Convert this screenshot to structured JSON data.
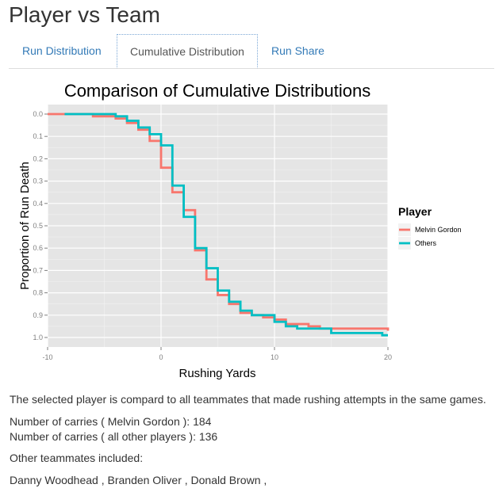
{
  "page": {
    "title": "Player vs Team"
  },
  "tabs": [
    {
      "label": "Run Distribution",
      "active": false
    },
    {
      "label": "Cumulative Distribution",
      "active": true
    },
    {
      "label": "Run Share",
      "active": false
    }
  ],
  "chart_data": {
    "type": "line",
    "subtype": "step",
    "title": "Comparison of Cumulative Distributions",
    "xlabel": "Rushing Yards",
    "ylabel": "Proportion of Run Death",
    "xlim": [
      -10,
      20
    ],
    "ylim": [
      0.0,
      1.0
    ],
    "y_reversed": true,
    "x_ticks": [
      -10,
      0,
      10,
      20
    ],
    "y_ticks": [
      "0.0",
      "0.1",
      "0.2",
      "0.3",
      "0.4",
      "0.5",
      "0.6",
      "0.7",
      "0.8",
      "0.9",
      "1.0"
    ],
    "grid": true,
    "background": "#e5e5e5",
    "legend": {
      "title": "Player",
      "position": "right"
    },
    "series": [
      {
        "name": "Melvin Gordon",
        "color": "#f8766d",
        "points": [
          [
            -10,
            0.0
          ],
          [
            -6,
            0.01
          ],
          [
            -4,
            0.02
          ],
          [
            -3,
            0.04
          ],
          [
            -2,
            0.07
          ],
          [
            -1,
            0.12
          ],
          [
            0,
            0.24
          ],
          [
            1,
            0.35
          ],
          [
            2,
            0.43
          ],
          [
            3,
            0.61
          ],
          [
            4,
            0.74
          ],
          [
            5,
            0.81
          ],
          [
            6,
            0.85
          ],
          [
            7,
            0.89
          ],
          [
            8,
            0.9
          ],
          [
            9,
            0.91
          ],
          [
            10,
            0.92
          ],
          [
            11,
            0.94
          ],
          [
            13,
            0.95
          ],
          [
            14,
            0.96
          ],
          [
            20,
            0.97
          ]
        ]
      },
      {
        "name": "Others",
        "color": "#00bfc4",
        "points": [
          [
            -8.5,
            0.0
          ],
          [
            -4,
            0.01
          ],
          [
            -3,
            0.03
          ],
          [
            -2,
            0.06
          ],
          [
            -1,
            0.09
          ],
          [
            0,
            0.14
          ],
          [
            1,
            0.32
          ],
          [
            2,
            0.46
          ],
          [
            3,
            0.6
          ],
          [
            4,
            0.69
          ],
          [
            5,
            0.79
          ],
          [
            6,
            0.84
          ],
          [
            7,
            0.88
          ],
          [
            8,
            0.9
          ],
          [
            10,
            0.93
          ],
          [
            11,
            0.95
          ],
          [
            12,
            0.96
          ],
          [
            15,
            0.98
          ],
          [
            19.5,
            0.99
          ],
          [
            20,
            0.99
          ]
        ]
      }
    ]
  },
  "footer": {
    "description": "The selected player is compard to all teammates that made rushing attempts in the same games.",
    "carries_player": "Number of carries ( Melvin Gordon ): 184",
    "carries_others": "Number of carries ( all other players ): 136",
    "teammates_label": "Other teammates included:",
    "teammates_list": "Danny Woodhead , Branden Oliver , Donald Brown ,"
  }
}
